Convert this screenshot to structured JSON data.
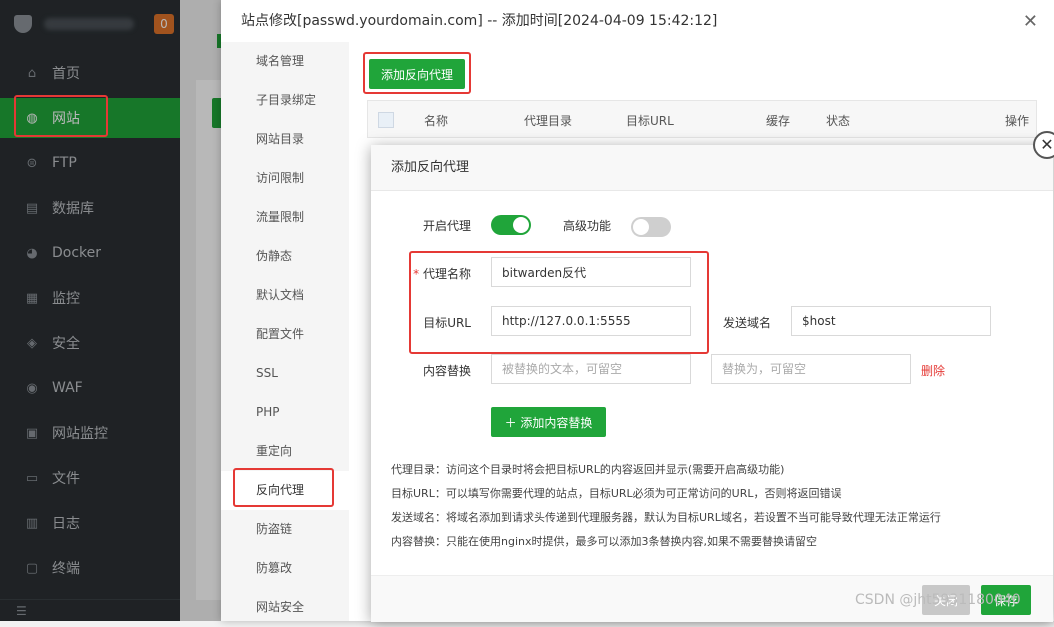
{
  "sidebar": {
    "badge": "0",
    "items": [
      {
        "label": "首页",
        "icon": "home-icon",
        "glyph": "⌂"
      },
      {
        "label": "网站",
        "icon": "globe-icon",
        "glyph": "◍",
        "active": true
      },
      {
        "label": "FTP",
        "icon": "ftp-icon",
        "glyph": "⊜"
      },
      {
        "label": "数据库",
        "icon": "database-icon",
        "glyph": "▤"
      },
      {
        "label": "Docker",
        "icon": "docker-icon",
        "glyph": "◕"
      },
      {
        "label": "监控",
        "icon": "monitor-icon",
        "glyph": "▦"
      },
      {
        "label": "安全",
        "icon": "shield-icon",
        "glyph": "◈"
      },
      {
        "label": "WAF",
        "icon": "waf-icon",
        "glyph": "◉"
      },
      {
        "label": "网站监控",
        "icon": "site-monitor-icon",
        "glyph": "▣"
      },
      {
        "label": "文件",
        "icon": "folder-icon",
        "glyph": "▭"
      },
      {
        "label": "日志",
        "icon": "log-icon",
        "glyph": "▥"
      },
      {
        "label": "终端",
        "icon": "terminal-icon",
        "glyph": "▢"
      }
    ]
  },
  "dialog": {
    "title": "站点修改[passwd.yourdomain.com] -- 添加时间[2024-04-09 15:42:12]",
    "close": "✕",
    "tabs": [
      "域名管理",
      "子目录绑定",
      "网站目录",
      "访问限制",
      "流量限制",
      "伪静态",
      "默认文档",
      "配置文件",
      "SSL",
      "PHP",
      "重定向",
      "反向代理",
      "防盗链",
      "防篡改",
      "网站安全"
    ],
    "active_tab": "反向代理",
    "add_proxy_label": "添加反向代理",
    "table_headers": [
      "名称",
      "代理目录",
      "目标URL",
      "缓存",
      "状态",
      "操作"
    ]
  },
  "modal": {
    "title": "添加反向代理",
    "close": "✕",
    "enable_proxy_label": "开启代理",
    "advanced_label": "高级功能",
    "proxy_name_label": "代理名称",
    "proxy_name_value": "bitwarden反代",
    "target_url_label": "目标URL",
    "target_url_value": "http://127.0.0.1:5555",
    "send_domain_label": "发送域名",
    "send_domain_value": "$host",
    "content_replace_label": "内容替换",
    "replace_from_placeholder": "被替换的文本，可留空",
    "replace_to_placeholder": "替换为，可留空",
    "delete_label": "删除",
    "add_content_label": "＋ 添加内容替换",
    "help": [
      "代理目录：访问这个目录时将会把目标URL的内容返回并显示(需要开启高级功能)",
      "目标URL：可以填写你需要代理的站点，目标URL必须为可正常访问的URL，否则将返回错误",
      "发送域名：将域名添加到请求头传递到代理服务器，默认为目标URL域名，若设置不当可能导致代理无法正常运行",
      "内容替换：只能在使用nginx时提供，最多可以添加3条替换内容,如果不需要替换请留空"
    ],
    "cancel_label": "关闭",
    "save_label": "保存"
  },
  "watermark": "CSDN @jht5931180040"
}
